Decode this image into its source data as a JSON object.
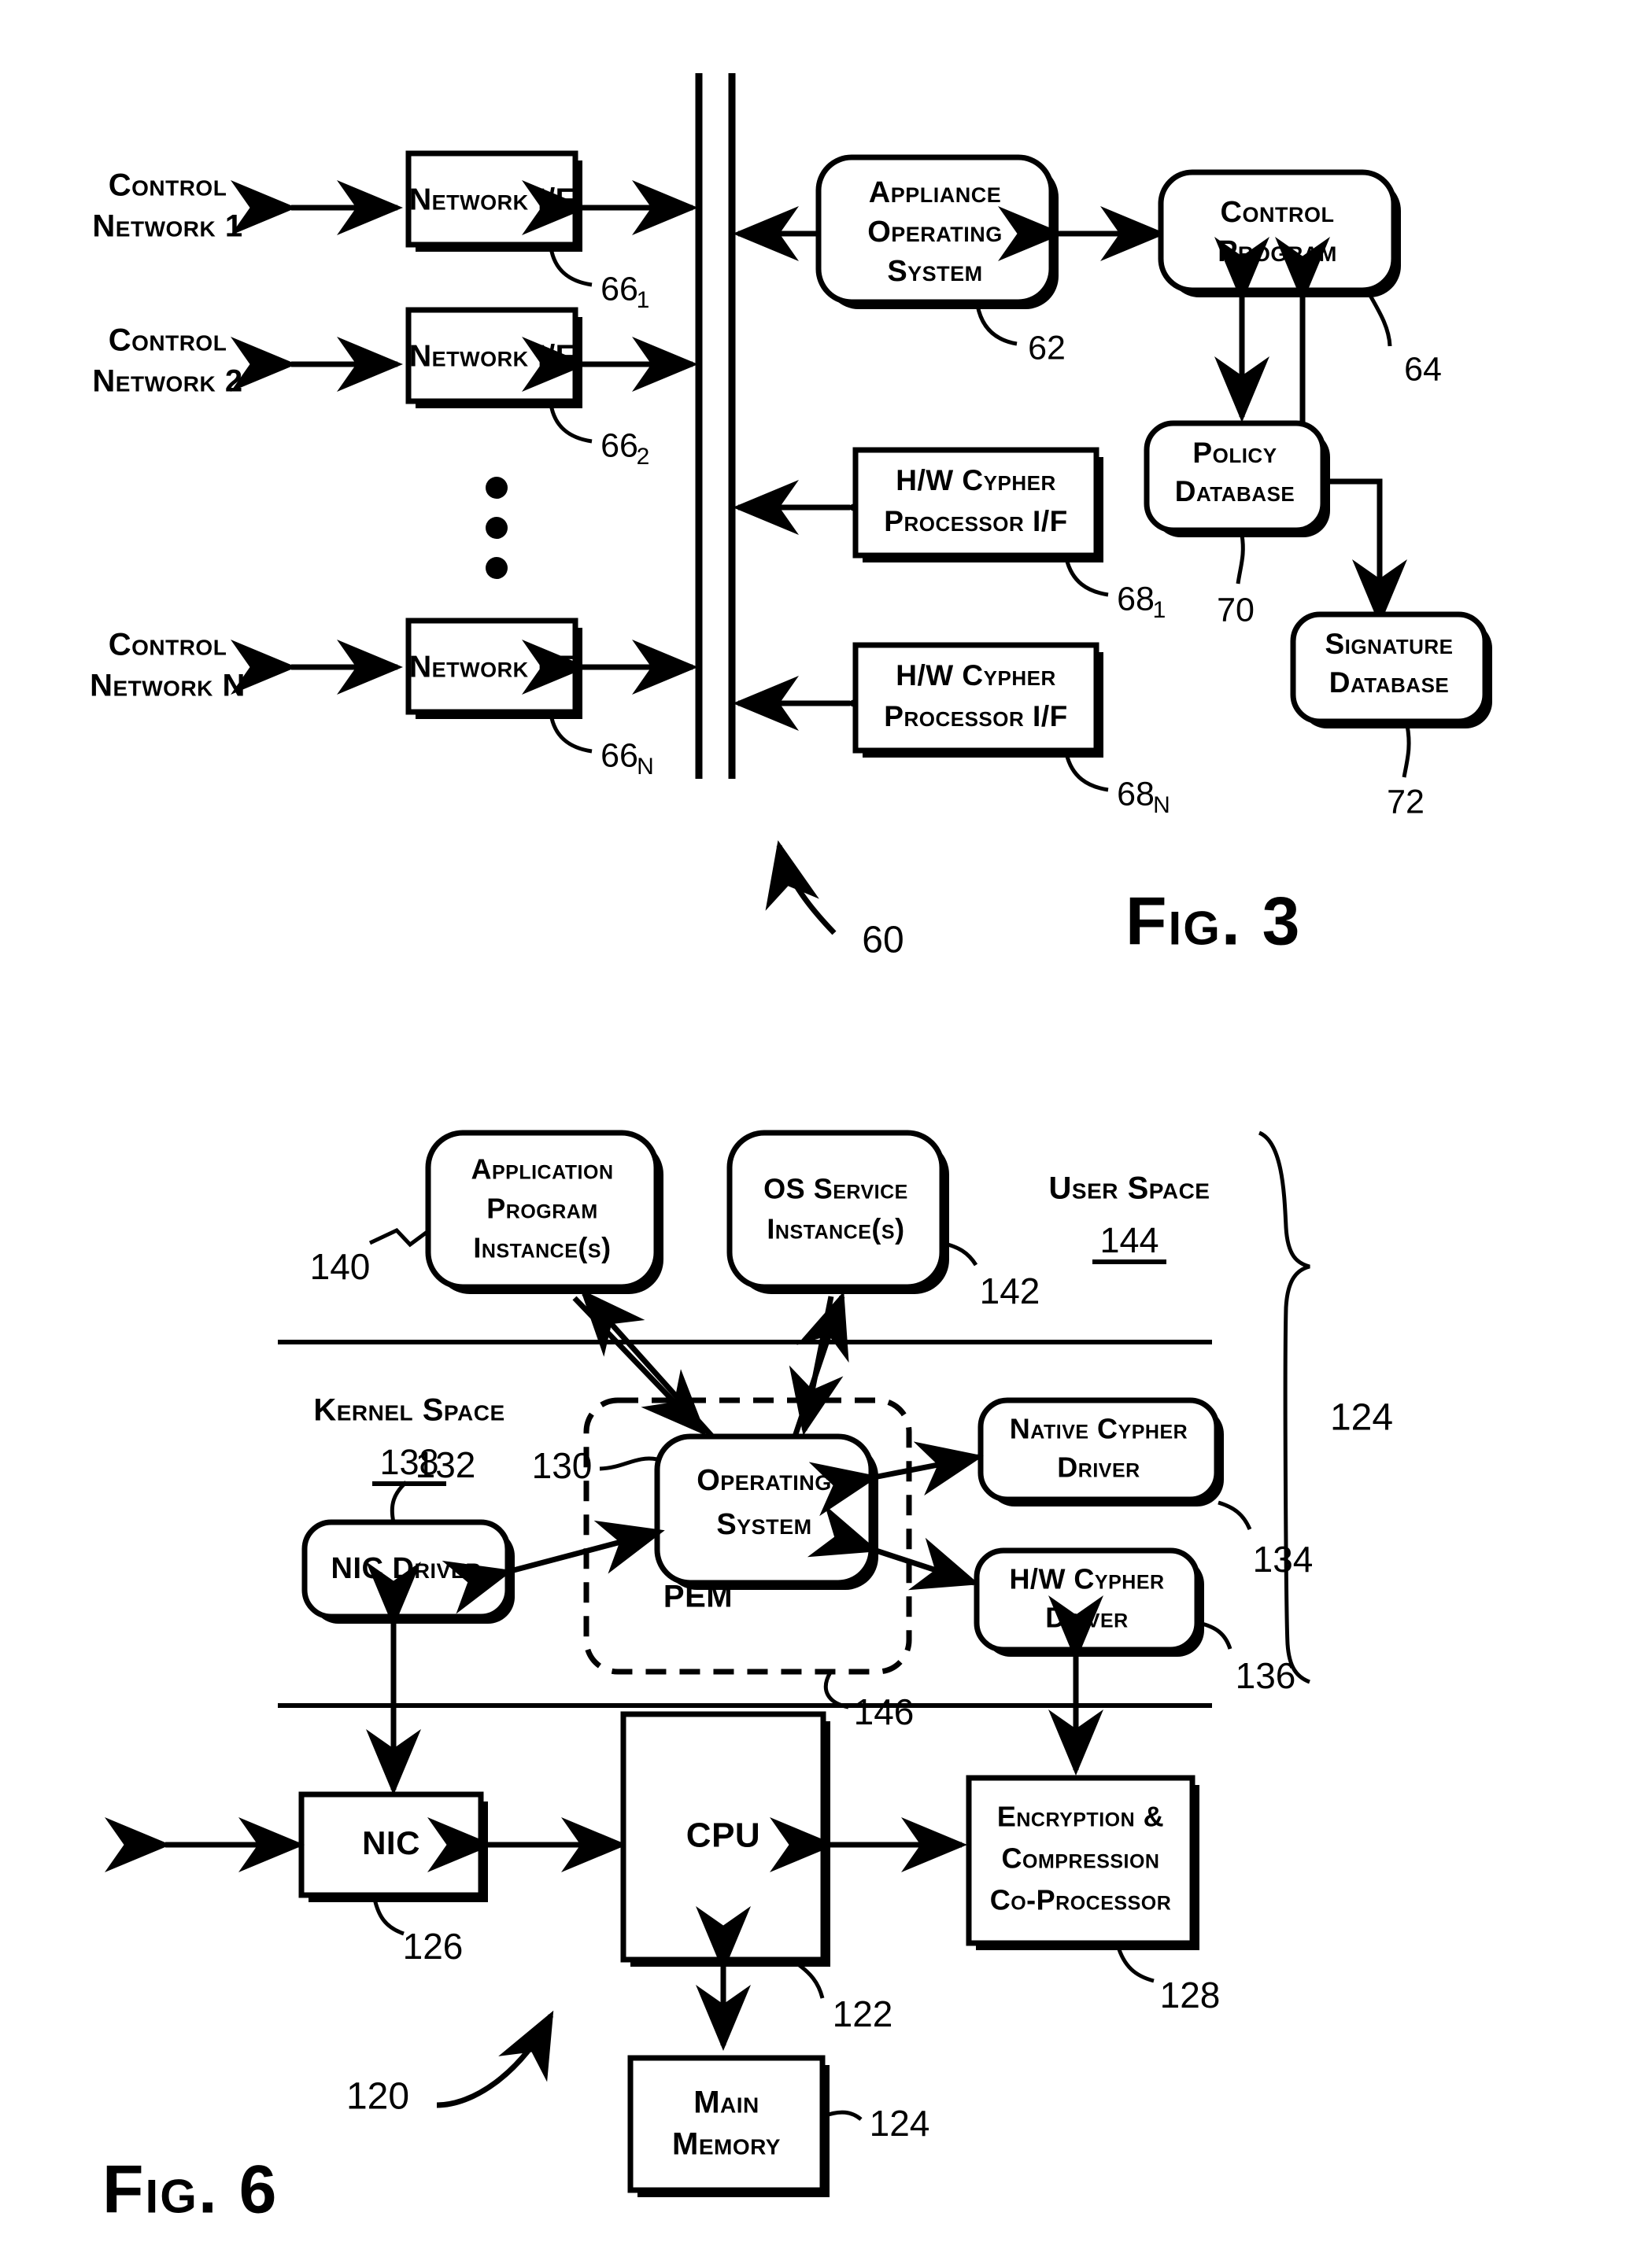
{
  "figures": [
    {
      "id": "fig3",
      "caption": "Fig. 3",
      "system_ref": "60",
      "networks": [
        {
          "label_line1": "Control",
          "label_line2": "Network 1",
          "iface_label": "Network I/F",
          "iface_ref_base": "66",
          "iface_ref_sub": "1"
        },
        {
          "label_line1": "Control",
          "label_line2": "Network 2",
          "iface_label": "Network I/F",
          "iface_ref_base": "66",
          "iface_ref_sub": "2"
        },
        {
          "label_line1": "Control",
          "label_line2": "Network N",
          "iface_label": "Network I/F",
          "iface_ref_base": "66",
          "iface_ref_sub": "N"
        }
      ],
      "ellipsis_note": "vertical dots indicating additional control networks",
      "blocks": [
        {
          "name": "appliance-operating-system",
          "lines": [
            "Appliance",
            "Operating",
            "System"
          ],
          "ref": "62",
          "shape": "rounded"
        },
        {
          "name": "control-program",
          "lines": [
            "Control",
            "Program"
          ],
          "ref": "64",
          "shape": "rounded"
        },
        {
          "name": "policy-database",
          "lines": [
            "Policy",
            "Database"
          ],
          "ref": "70",
          "shape": "rounded"
        },
        {
          "name": "signature-database",
          "lines": [
            "Signature",
            "Database"
          ],
          "ref": "72",
          "shape": "rounded"
        },
        {
          "name": "hw-cypher-processor-if-1",
          "lines": [
            "H/W Cypher",
            "Processor I/F"
          ],
          "ref_base": "68",
          "ref_sub": "1",
          "shape": "rect"
        },
        {
          "name": "hw-cypher-processor-if-n",
          "lines": [
            "H/W Cypher",
            "Processor I/F"
          ],
          "ref_base": "68",
          "ref_sub": "N",
          "shape": "rect"
        }
      ]
    },
    {
      "id": "fig6",
      "caption": "Fig. 6",
      "system_ref": "120",
      "bracket_ref": "124",
      "regions": [
        {
          "name": "user-space",
          "label": "User Space",
          "ref": "144"
        },
        {
          "name": "kernel-space",
          "label": "Kernel Space",
          "ref": "138"
        }
      ],
      "blocks": [
        {
          "name": "application-program-instances",
          "lines": [
            "Application",
            "Program",
            "Instance(s)"
          ],
          "ref": "140",
          "shape": "rounded"
        },
        {
          "name": "os-service-instances",
          "lines": [
            "OS Service",
            "Instance(s)"
          ],
          "ref": "142",
          "shape": "rounded"
        },
        {
          "name": "operating-system",
          "lines": [
            "Operating",
            "System"
          ],
          "ref": "130",
          "shape": "rounded"
        },
        {
          "name": "pem-boundary",
          "label": "PEM",
          "ref": "146",
          "shape": "dashed"
        },
        {
          "name": "nic-driver",
          "lines": [
            "NIC Driver"
          ],
          "ref": "132",
          "shape": "rounded"
        },
        {
          "name": "native-cypher-driver",
          "lines": [
            "Native Cypher",
            "Driver"
          ],
          "ref": "134",
          "shape": "rounded"
        },
        {
          "name": "hw-cypher-driver",
          "lines": [
            "H/W Cypher",
            "Driver"
          ],
          "ref": "136",
          "shape": "rounded"
        },
        {
          "name": "nic",
          "lines": [
            "NIC"
          ],
          "ref": "126",
          "shape": "rect"
        },
        {
          "name": "cpu",
          "lines": [
            "CPU"
          ],
          "ref": "122",
          "shape": "rect"
        },
        {
          "name": "encryption-compression-co-processor",
          "lines": [
            "Encryption &",
            "Compression",
            "Co-Processor"
          ],
          "ref": "128",
          "shape": "rect"
        },
        {
          "name": "main-memory",
          "lines": [
            "Main",
            "Memory"
          ],
          "ref": "124",
          "shape": "rect"
        }
      ]
    }
  ],
  "fig3": {
    "caption": "Fig. 3",
    "system_ref": "60",
    "net1_l1": "Control",
    "net1_l2": "Network 1",
    "net2_l1": "Control",
    "net2_l2": "Network 2",
    "netn_l1": "Control",
    "netn_l2": "Network N",
    "iface_label": "Network I/F",
    "ref_66_1": "66",
    "ref_66_1_sub": "1",
    "ref_66_2": "66",
    "ref_66_2_sub": "2",
    "ref_66_n": "66",
    "ref_66_n_sub": "N",
    "aos_l1": "Appliance",
    "aos_l2": "Operating",
    "aos_l3": "System",
    "ref_62": "62",
    "cp_l1": "Control",
    "cp_l2": "Program",
    "ref_64": "64",
    "policy_l1": "Policy",
    "policy_l2": "Database",
    "ref_70": "70",
    "sig_l1": "Signature",
    "sig_l2": "Database",
    "ref_72": "72",
    "hwc_l1": "H/W Cypher",
    "hwc_l2": "Processor I/F",
    "ref_68_1": "68",
    "ref_68_1_sub": "1",
    "ref_68_n": "68",
    "ref_68_n_sub": "N"
  },
  "fig6": {
    "caption": "Fig. 6",
    "system_ref": "120",
    "bracket_ref": "124",
    "app_l1": "Application",
    "app_l2": "Program",
    "app_l3": "Instance(s)",
    "ref_140": "140",
    "oss_l1": "OS Service",
    "oss_l2": "Instance(s)",
    "ref_142": "142",
    "userspace_label": "User Space",
    "ref_144": "144",
    "kernelspace_label": "Kernel Space",
    "ref_138": "138",
    "os_l1": "Operating",
    "os_l2": "System",
    "ref_130": "130",
    "pem_label": "PEM",
    "ref_146": "146",
    "nicdrv_label": "NIC Driver",
    "ref_132": "132",
    "ncd_l1": "Native Cypher",
    "ncd_l2": "Driver",
    "ref_134": "134",
    "hcd_l1": "H/W Cypher",
    "hcd_l2": "Driver",
    "ref_136": "136",
    "nic_label": "NIC",
    "ref_126": "126",
    "cpu_label": "CPU",
    "ref_122": "122",
    "ecc_l1": "Encryption &",
    "ecc_l2": "Compression",
    "ecc_l3": "Co-Processor",
    "ref_128": "128",
    "mm_l1": "Main",
    "mm_l2": "Memory",
    "ref_124": "124"
  }
}
